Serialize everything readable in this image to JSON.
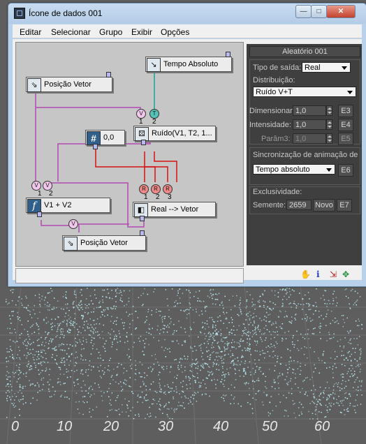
{
  "window": {
    "title": "Ícone de dados 001",
    "controls": {
      "minimize": "—",
      "maximize": "□",
      "close": "✕"
    }
  },
  "menu": [
    "Editar",
    "Selecionar",
    "Grupo",
    "Exibir",
    "Opções"
  ],
  "nodes": {
    "tempo": {
      "label": "Tempo Absoluto",
      "icon": "clock-arrow-icon"
    },
    "posin": {
      "label": "Posição Vetor",
      "icon": "position-arrow-icon"
    },
    "num": {
      "label": "0,0",
      "icon": "#"
    },
    "ruido": {
      "label": "Ruído(V1, T2, 1...",
      "icon": "dice-icon"
    },
    "soma": {
      "label": "V1 + V2",
      "icon": "f"
    },
    "conv": {
      "label": "Real --> Vetor",
      "icon": "convert-icon"
    },
    "posout": {
      "label": "Posição Vetor",
      "icon": "position-arrow-icon"
    }
  },
  "ports": {
    "v": "V",
    "t": "T",
    "r": "R",
    "n1": "1",
    "n2": "2",
    "n3": "3"
  },
  "panel": {
    "title": "Aleatório 001",
    "tipo_label": "Tipo de saída:",
    "tipo_value": "Real",
    "dist_label": "Distribuição:",
    "dist_value": "Ruído V+T",
    "dim_label": "Dimensionar:",
    "dim_value": "1,0",
    "dim_btn": "E3",
    "int_label": "Intensidade:",
    "int_value": "1,0",
    "int_btn": "E4",
    "par_label": "Parâm3:",
    "par_value": "1,0",
    "par_btn": "E5",
    "sync_label": "Sincronização de animação de",
    "sync_value": "Tempo absoluto",
    "sync_btn": "E6",
    "excl_label": "Exclusividade:",
    "seed_label": "Semente:",
    "seed_value": "2659",
    "novo_btn": "Novo",
    "seed_btn": "E7"
  },
  "statusbar_icons": [
    "hand-pan-icon",
    "info-icon",
    "cursor-icon",
    "move-icon"
  ],
  "axis_labels": [
    "0",
    "10",
    "20",
    "30",
    "40",
    "50",
    "60"
  ]
}
